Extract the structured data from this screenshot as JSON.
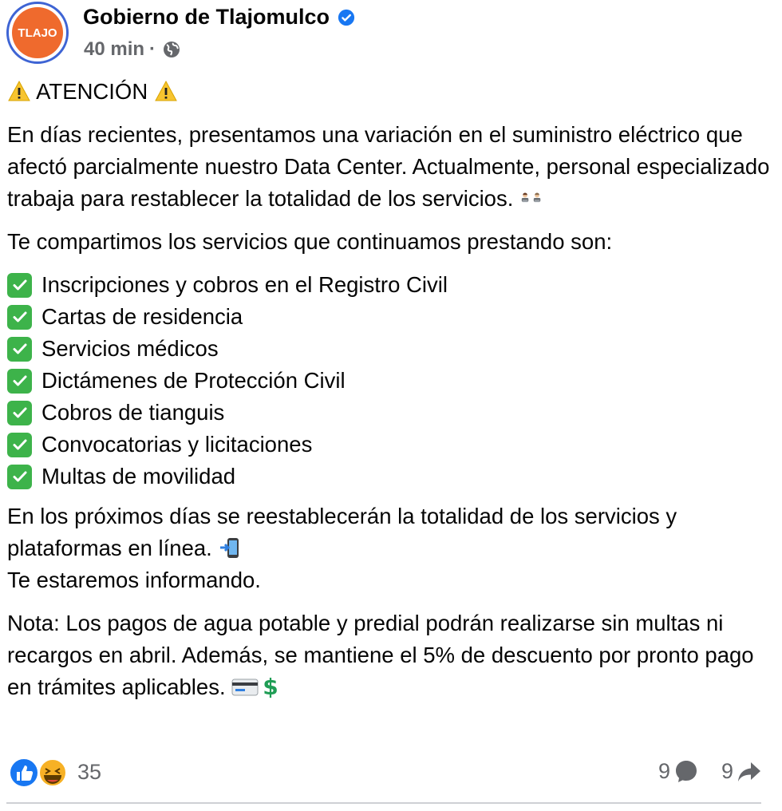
{
  "post": {
    "author": "Gobierno de Tlajomulco",
    "avatar_text": "TLAJO",
    "time": "40 min",
    "separator": "·",
    "heading": "ATENCIÓN",
    "paragraph1": "En días recientes, presentamos una variación en el suministro eléctrico que afectó parcialmente nuestro Data Center. Actualmente, personal especializado trabaja para restablecer la totalidad de los servicios.",
    "paragraph2": "Te compartimos los servicios que continuamos prestando son:",
    "services": [
      "Inscripciones y cobros en el Registro Civil",
      "Cartas de residencia",
      "Servicios médicos",
      "Dictámenes de Protección Civil",
      "Cobros de tianguis",
      "Convocatorias y licitaciones",
      "Multas de movilidad"
    ],
    "paragraph3_line1": "En los próximos días se reestablecerán la totalidad de los servicios y plataformas en línea.",
    "paragraph3_line2": "Te estaremos informando.",
    "paragraph4": "Nota: Los pagos de agua potable y predial podrán realizarse sin multas ni recargos en abril. Además, se mantiene el 5% de descuento por pronto pago en trámites aplicables."
  },
  "footer": {
    "reactions_count": "35",
    "comments_count": "9",
    "shares_count": "9"
  },
  "colors": {
    "verified": "#1877f2",
    "avatar_border": "#3e64d4",
    "avatar_bg": "#ef6a2d",
    "check_bg": "#3db34a",
    "secondary_text": "#65676b"
  },
  "icons": [
    "verified-badge-icon",
    "globe-icon",
    "warning-icon",
    "people-working-icon",
    "phone-arrow-icon",
    "credit-card-icon",
    "dollar-icon",
    "check-icon",
    "like-icon",
    "haha-icon",
    "comment-icon",
    "share-icon"
  ]
}
